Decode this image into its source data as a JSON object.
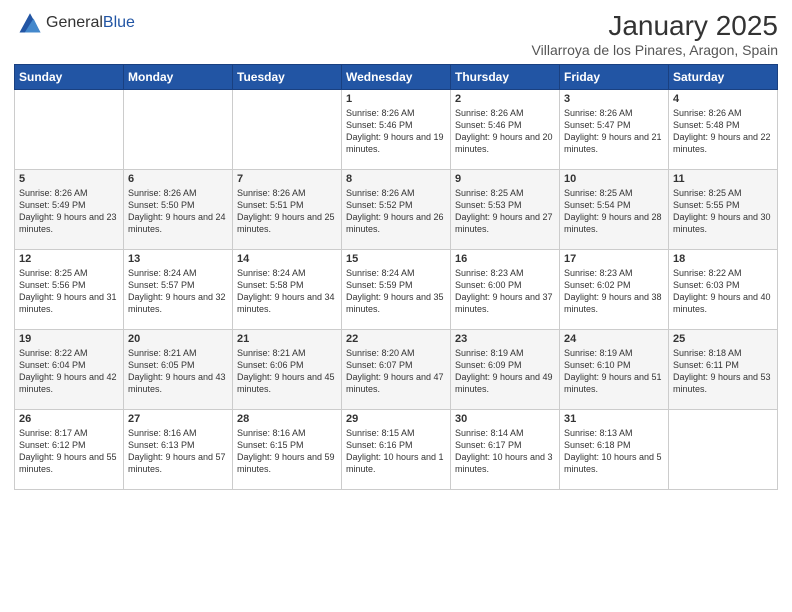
{
  "logo": {
    "general": "General",
    "blue": "Blue"
  },
  "title": "January 2025",
  "subtitle": "Villarroya de los Pinares, Aragon, Spain",
  "days_of_week": [
    "Sunday",
    "Monday",
    "Tuesday",
    "Wednesday",
    "Thursday",
    "Friday",
    "Saturday"
  ],
  "weeks": [
    [
      {
        "day": "",
        "sunrise": "",
        "sunset": "",
        "daylight": ""
      },
      {
        "day": "",
        "sunrise": "",
        "sunset": "",
        "daylight": ""
      },
      {
        "day": "",
        "sunrise": "",
        "sunset": "",
        "daylight": ""
      },
      {
        "day": "1",
        "sunrise": "Sunrise: 8:26 AM",
        "sunset": "Sunset: 5:46 PM",
        "daylight": "Daylight: 9 hours and 19 minutes."
      },
      {
        "day": "2",
        "sunrise": "Sunrise: 8:26 AM",
        "sunset": "Sunset: 5:46 PM",
        "daylight": "Daylight: 9 hours and 20 minutes."
      },
      {
        "day": "3",
        "sunrise": "Sunrise: 8:26 AM",
        "sunset": "Sunset: 5:47 PM",
        "daylight": "Daylight: 9 hours and 21 minutes."
      },
      {
        "day": "4",
        "sunrise": "Sunrise: 8:26 AM",
        "sunset": "Sunset: 5:48 PM",
        "daylight": "Daylight: 9 hours and 22 minutes."
      }
    ],
    [
      {
        "day": "5",
        "sunrise": "Sunrise: 8:26 AM",
        "sunset": "Sunset: 5:49 PM",
        "daylight": "Daylight: 9 hours and 23 minutes."
      },
      {
        "day": "6",
        "sunrise": "Sunrise: 8:26 AM",
        "sunset": "Sunset: 5:50 PM",
        "daylight": "Daylight: 9 hours and 24 minutes."
      },
      {
        "day": "7",
        "sunrise": "Sunrise: 8:26 AM",
        "sunset": "Sunset: 5:51 PM",
        "daylight": "Daylight: 9 hours and 25 minutes."
      },
      {
        "day": "8",
        "sunrise": "Sunrise: 8:26 AM",
        "sunset": "Sunset: 5:52 PM",
        "daylight": "Daylight: 9 hours and 26 minutes."
      },
      {
        "day": "9",
        "sunrise": "Sunrise: 8:25 AM",
        "sunset": "Sunset: 5:53 PM",
        "daylight": "Daylight: 9 hours and 27 minutes."
      },
      {
        "day": "10",
        "sunrise": "Sunrise: 8:25 AM",
        "sunset": "Sunset: 5:54 PM",
        "daylight": "Daylight: 9 hours and 28 minutes."
      },
      {
        "day": "11",
        "sunrise": "Sunrise: 8:25 AM",
        "sunset": "Sunset: 5:55 PM",
        "daylight": "Daylight: 9 hours and 30 minutes."
      }
    ],
    [
      {
        "day": "12",
        "sunrise": "Sunrise: 8:25 AM",
        "sunset": "Sunset: 5:56 PM",
        "daylight": "Daylight: 9 hours and 31 minutes."
      },
      {
        "day": "13",
        "sunrise": "Sunrise: 8:24 AM",
        "sunset": "Sunset: 5:57 PM",
        "daylight": "Daylight: 9 hours and 32 minutes."
      },
      {
        "day": "14",
        "sunrise": "Sunrise: 8:24 AM",
        "sunset": "Sunset: 5:58 PM",
        "daylight": "Daylight: 9 hours and 34 minutes."
      },
      {
        "day": "15",
        "sunrise": "Sunrise: 8:24 AM",
        "sunset": "Sunset: 5:59 PM",
        "daylight": "Daylight: 9 hours and 35 minutes."
      },
      {
        "day": "16",
        "sunrise": "Sunrise: 8:23 AM",
        "sunset": "Sunset: 6:00 PM",
        "daylight": "Daylight: 9 hours and 37 minutes."
      },
      {
        "day": "17",
        "sunrise": "Sunrise: 8:23 AM",
        "sunset": "Sunset: 6:02 PM",
        "daylight": "Daylight: 9 hours and 38 minutes."
      },
      {
        "day": "18",
        "sunrise": "Sunrise: 8:22 AM",
        "sunset": "Sunset: 6:03 PM",
        "daylight": "Daylight: 9 hours and 40 minutes."
      }
    ],
    [
      {
        "day": "19",
        "sunrise": "Sunrise: 8:22 AM",
        "sunset": "Sunset: 6:04 PM",
        "daylight": "Daylight: 9 hours and 42 minutes."
      },
      {
        "day": "20",
        "sunrise": "Sunrise: 8:21 AM",
        "sunset": "Sunset: 6:05 PM",
        "daylight": "Daylight: 9 hours and 43 minutes."
      },
      {
        "day": "21",
        "sunrise": "Sunrise: 8:21 AM",
        "sunset": "Sunset: 6:06 PM",
        "daylight": "Daylight: 9 hours and 45 minutes."
      },
      {
        "day": "22",
        "sunrise": "Sunrise: 8:20 AM",
        "sunset": "Sunset: 6:07 PM",
        "daylight": "Daylight: 9 hours and 47 minutes."
      },
      {
        "day": "23",
        "sunrise": "Sunrise: 8:19 AM",
        "sunset": "Sunset: 6:09 PM",
        "daylight": "Daylight: 9 hours and 49 minutes."
      },
      {
        "day": "24",
        "sunrise": "Sunrise: 8:19 AM",
        "sunset": "Sunset: 6:10 PM",
        "daylight": "Daylight: 9 hours and 51 minutes."
      },
      {
        "day": "25",
        "sunrise": "Sunrise: 8:18 AM",
        "sunset": "Sunset: 6:11 PM",
        "daylight": "Daylight: 9 hours and 53 minutes."
      }
    ],
    [
      {
        "day": "26",
        "sunrise": "Sunrise: 8:17 AM",
        "sunset": "Sunset: 6:12 PM",
        "daylight": "Daylight: 9 hours and 55 minutes."
      },
      {
        "day": "27",
        "sunrise": "Sunrise: 8:16 AM",
        "sunset": "Sunset: 6:13 PM",
        "daylight": "Daylight: 9 hours and 57 minutes."
      },
      {
        "day": "28",
        "sunrise": "Sunrise: 8:16 AM",
        "sunset": "Sunset: 6:15 PM",
        "daylight": "Daylight: 9 hours and 59 minutes."
      },
      {
        "day": "29",
        "sunrise": "Sunrise: 8:15 AM",
        "sunset": "Sunset: 6:16 PM",
        "daylight": "Daylight: 10 hours and 1 minute."
      },
      {
        "day": "30",
        "sunrise": "Sunrise: 8:14 AM",
        "sunset": "Sunset: 6:17 PM",
        "daylight": "Daylight: 10 hours and 3 minutes."
      },
      {
        "day": "31",
        "sunrise": "Sunrise: 8:13 AM",
        "sunset": "Sunset: 6:18 PM",
        "daylight": "Daylight: 10 hours and 5 minutes."
      },
      {
        "day": "",
        "sunrise": "",
        "sunset": "",
        "daylight": ""
      }
    ]
  ]
}
